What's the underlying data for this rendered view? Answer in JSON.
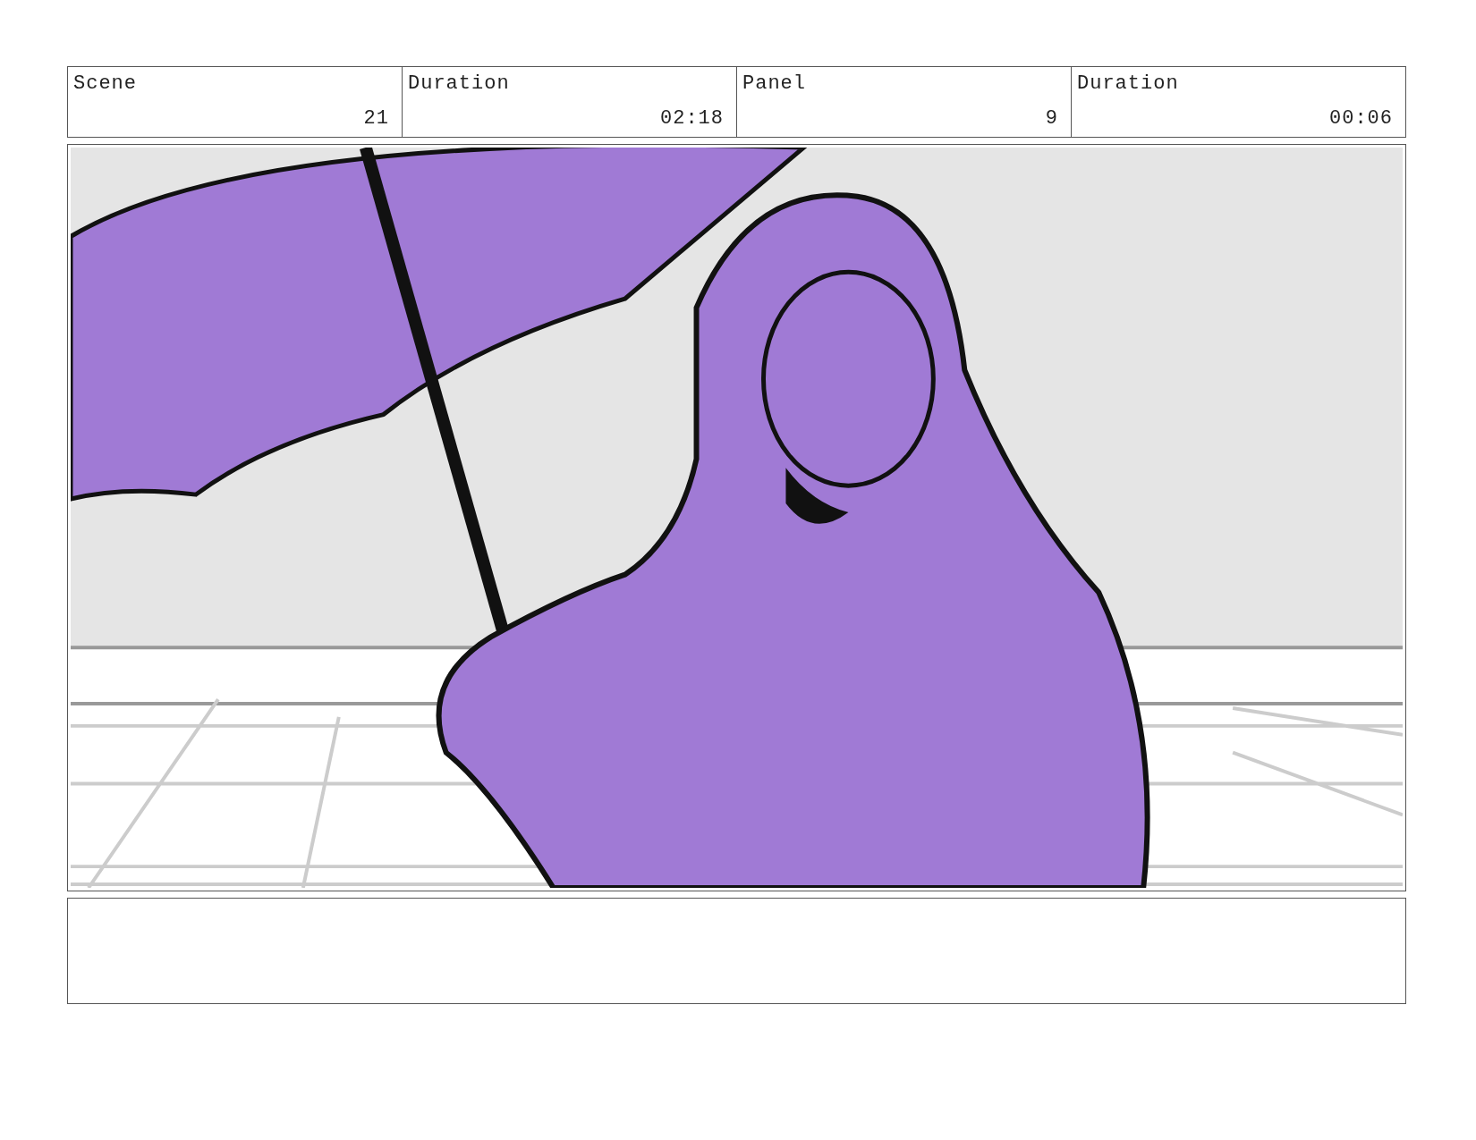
{
  "header": [
    {
      "label": "Scene",
      "value": "21"
    },
    {
      "label": "Duration",
      "value": "02:18"
    },
    {
      "label": "Panel",
      "value": "9"
    },
    {
      "label": "Duration",
      "value": "00:06"
    }
  ]
}
